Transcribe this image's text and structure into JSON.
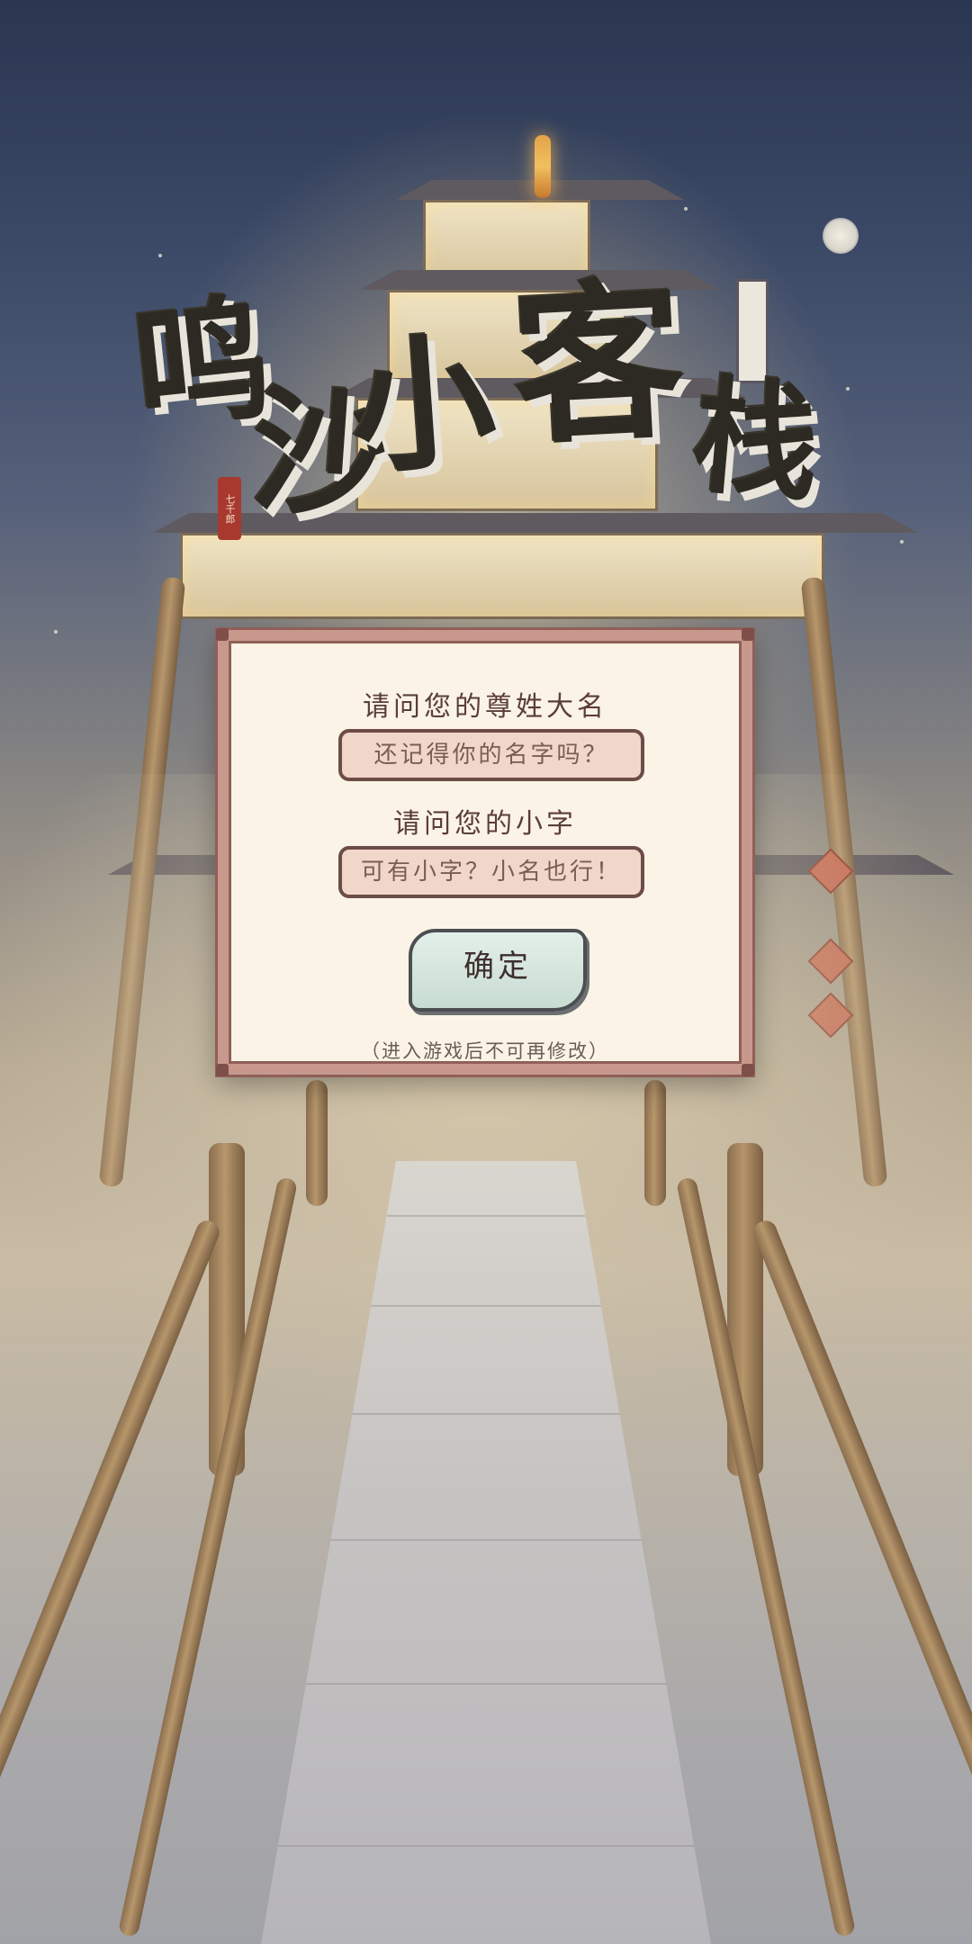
{
  "title": {
    "chars": [
      "鸣",
      "沙",
      "小",
      "客",
      "栈"
    ],
    "seal_text": "七千郎"
  },
  "dialog": {
    "surname_label": "请问您的尊姓大名",
    "surname_placeholder": "还记得你的名字吗？",
    "nickname_label": "请问您的小字",
    "nickname_placeholder": "可有小字？小名也行！",
    "confirm_label": "确定",
    "note": "（进入游戏后不可再修改）"
  },
  "colors": {
    "dialog_bg": "#fbf4e6",
    "dialog_border": "#c9988d",
    "input_bg": "#f0d7c9",
    "confirm_bg": "#d6e6df",
    "text": "#5b3d38"
  }
}
